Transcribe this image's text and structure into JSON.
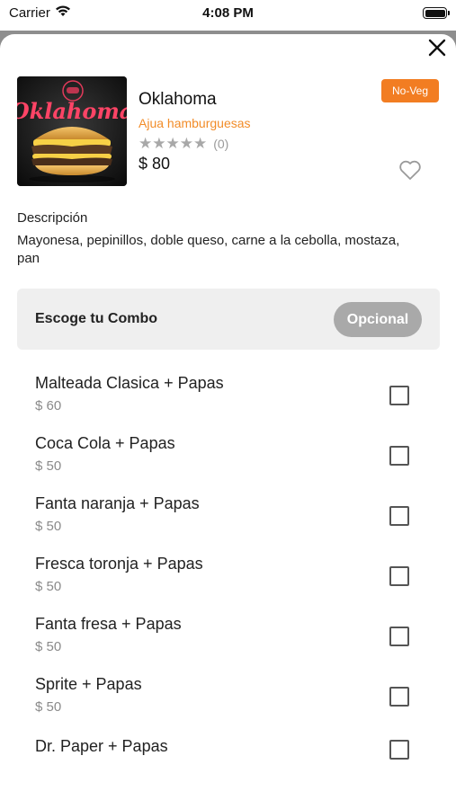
{
  "status_bar": {
    "carrier": "Carrier",
    "time": "4:08 PM"
  },
  "product": {
    "name": "Oklahoma",
    "restaurant": "Ajua hamburguesas",
    "stars": "★★★★★",
    "rating_count": "(0)",
    "price": "$ 80",
    "veg_badge": "No-Veg",
    "image_text": "Oklahoma"
  },
  "description": {
    "title": "Descripción",
    "text": "Mayonesa, pepinillos, doble queso, carne a la cebolla, mostaza, pan"
  },
  "combo": {
    "title": "Escoge tu Combo",
    "optional_label": "Opcional",
    "options": [
      {
        "name": "Malteada Clasica + Papas",
        "price": "$ 60"
      },
      {
        "name": "Coca Cola + Papas",
        "price": "$ 50"
      },
      {
        "name": "Fanta naranja + Papas",
        "price": "$ 50"
      },
      {
        "name": "Fresca toronja + Papas",
        "price": "$ 50"
      },
      {
        "name": "Fanta fresa + Papas",
        "price": "$ 50"
      },
      {
        "name": "Sprite + Papas",
        "price": "$ 50"
      },
      {
        "name": "Dr. Paper + Papas",
        "price": ""
      }
    ]
  },
  "colors": {
    "accent": "#f28c28",
    "badge": "#f27d22",
    "optional_pill": "#a9a9a9"
  },
  "icons": {
    "close": "close-icon",
    "wifi": "wifi-icon",
    "battery": "battery-icon",
    "favorite": "heart-icon",
    "checkbox": "checkbox-icon"
  }
}
